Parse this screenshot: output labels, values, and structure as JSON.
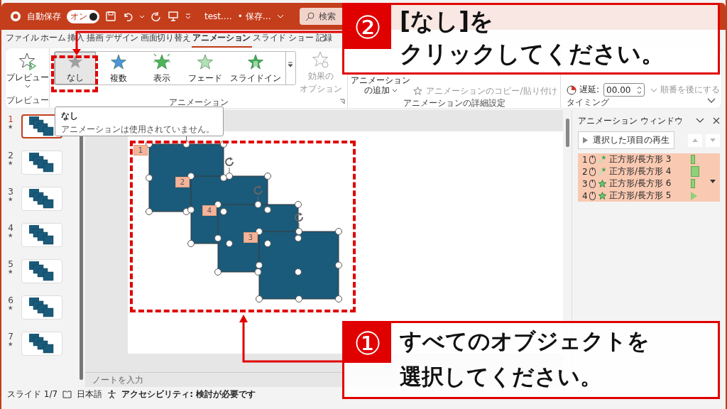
{
  "title_bar": {
    "autosave": {
      "label": "自動保存",
      "toggle_text": "オン",
      "on": true
    },
    "file_name": "test.…",
    "save_state": "• 保存…",
    "search": {
      "placeholder": "検索"
    }
  },
  "tabs": [
    {
      "label": "ファイル",
      "selected": false
    },
    {
      "label": "ホーム",
      "selected": false
    },
    {
      "label": "挿入",
      "selected": false
    },
    {
      "label": "描画",
      "selected": false
    },
    {
      "label": "デザイン",
      "selected": false
    },
    {
      "label": "画面切り替え",
      "selected": false
    },
    {
      "label": "アニメーション",
      "selected": true
    },
    {
      "label": "スライド ショー",
      "selected": false
    },
    {
      "label": "記録",
      "selected": false
    }
  ],
  "ribbon": {
    "preview_group": {
      "button": "プレビュー",
      "label": "プレビュー"
    },
    "animation_group": {
      "gallery": [
        {
          "label": "なし",
          "kind": "none",
          "selected": true
        },
        {
          "label": "複数",
          "kind": "multiple",
          "selected": false
        },
        {
          "label": "表示",
          "kind": "appear",
          "selected": false
        },
        {
          "label": "フェード",
          "kind": "fade",
          "selected": false
        },
        {
          "label": "スライドイン",
          "kind": "slidein",
          "selected": false
        }
      ],
      "effect_options": {
        "lines": [
          "効果の",
          "オプション"
        ],
        "disabled": true
      },
      "label": "アニメーション"
    },
    "advanced_group": {
      "add_button": [
        "アニメーション",
        "の追加"
      ],
      "copy_button": {
        "label": "アニメーションのコピー/貼り付け",
        "disabled": true
      },
      "label": "アニメーションの詳細設定"
    },
    "timing_group": {
      "delay": {
        "label": "遅延:",
        "value": "00.00"
      },
      "move_later": {
        "label": "順番を後にする",
        "disabled": true
      },
      "label": "タイミング"
    }
  },
  "tooltip": {
    "title": "なし",
    "text": "アニメーションは使用されていません。"
  },
  "slides": [
    {
      "number": "1",
      "selected": true
    },
    {
      "number": "2",
      "selected": false
    },
    {
      "number": "3",
      "selected": false
    },
    {
      "number": "4",
      "selected": false
    },
    {
      "number": "5",
      "selected": false
    },
    {
      "number": "6",
      "selected": false
    },
    {
      "number": "7",
      "selected": false
    }
  ],
  "slide": {
    "shapes": [
      {
        "badge": "1"
      },
      {
        "badge": "2"
      },
      {
        "badge": "4"
      },
      {
        "badge": "3"
      }
    ]
  },
  "notes": {
    "placeholder": "ノートを入力"
  },
  "animation_pane": {
    "title": "アニメーション ウィンドウ",
    "play_button": "選択した項目の再生",
    "items": [
      {
        "number": "1",
        "name": "正方形/長方形 3",
        "effect": {
          "kind": "fade"
        },
        "timeline": {
          "kind": "narrow"
        },
        "selected": true
      },
      {
        "number": "2",
        "name": "正方形/長方形 4",
        "effect": {
          "kind": "fade"
        },
        "timeline": {
          "kind": "wide"
        },
        "selected": true
      },
      {
        "number": "3",
        "name": "正方形/長方形 6",
        "effect": {
          "kind": "appear"
        },
        "timeline": {
          "kind": "narrow"
        },
        "selected": true
      },
      {
        "number": "4",
        "name": "正方形/長方形 5",
        "effect": {
          "kind": "appear"
        },
        "timeline": {
          "kind": "triangle"
        },
        "selected": true
      }
    ]
  },
  "status_bar": {
    "slide": "スライド 1/7",
    "language": "日本語",
    "accessibility": "アクセシビリティ: 検討が必要です"
  },
  "callouts": [
    {
      "number": "②",
      "lines": [
        "[なし]を",
        "クリックしてください。"
      ]
    },
    {
      "number": "①",
      "lines": [
        "すべてのオブジェクトを",
        "選択してください。"
      ]
    }
  ]
}
